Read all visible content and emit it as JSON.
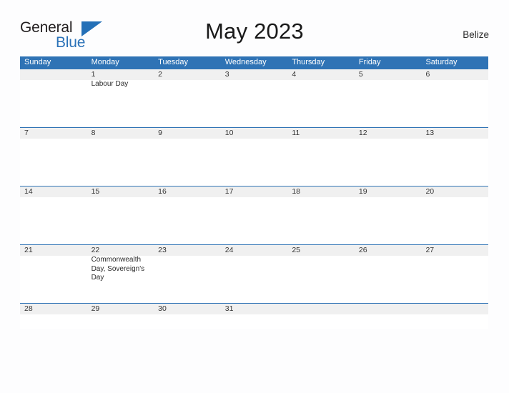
{
  "logo": {
    "word1": "General",
    "word2": "Blue",
    "triangle_color": "#2470b7"
  },
  "header": {
    "title": "May 2023",
    "region": "Belize"
  },
  "theme": {
    "header_blue": "#2f73b5",
    "band_gray": "#f0f0f0",
    "page_background": "#fdfdfe",
    "text_dark": "#333333"
  },
  "calendar": {
    "weekdays": [
      "Sunday",
      "Monday",
      "Tuesday",
      "Wednesday",
      "Thursday",
      "Friday",
      "Saturday"
    ],
    "weeks": [
      {
        "days": [
          {
            "num": "",
            "event": ""
          },
          {
            "num": "1",
            "event": "Labour Day"
          },
          {
            "num": "2",
            "event": ""
          },
          {
            "num": "3",
            "event": ""
          },
          {
            "num": "4",
            "event": ""
          },
          {
            "num": "5",
            "event": ""
          },
          {
            "num": "6",
            "event": ""
          }
        ]
      },
      {
        "days": [
          {
            "num": "7",
            "event": ""
          },
          {
            "num": "8",
            "event": ""
          },
          {
            "num": "9",
            "event": ""
          },
          {
            "num": "10",
            "event": ""
          },
          {
            "num": "11",
            "event": ""
          },
          {
            "num": "12",
            "event": ""
          },
          {
            "num": "13",
            "event": ""
          }
        ]
      },
      {
        "days": [
          {
            "num": "14",
            "event": ""
          },
          {
            "num": "15",
            "event": ""
          },
          {
            "num": "16",
            "event": ""
          },
          {
            "num": "17",
            "event": ""
          },
          {
            "num": "18",
            "event": ""
          },
          {
            "num": "19",
            "event": ""
          },
          {
            "num": "20",
            "event": ""
          }
        ]
      },
      {
        "days": [
          {
            "num": "21",
            "event": ""
          },
          {
            "num": "22",
            "event": "Commonwealth Day, Sovereign's Day"
          },
          {
            "num": "23",
            "event": ""
          },
          {
            "num": "24",
            "event": ""
          },
          {
            "num": "25",
            "event": ""
          },
          {
            "num": "26",
            "event": ""
          },
          {
            "num": "27",
            "event": ""
          }
        ]
      },
      {
        "days": [
          {
            "num": "28",
            "event": ""
          },
          {
            "num": "29",
            "event": ""
          },
          {
            "num": "30",
            "event": ""
          },
          {
            "num": "31",
            "event": ""
          },
          {
            "num": "",
            "event": ""
          },
          {
            "num": "",
            "event": ""
          },
          {
            "num": "",
            "event": ""
          }
        ]
      }
    ]
  }
}
